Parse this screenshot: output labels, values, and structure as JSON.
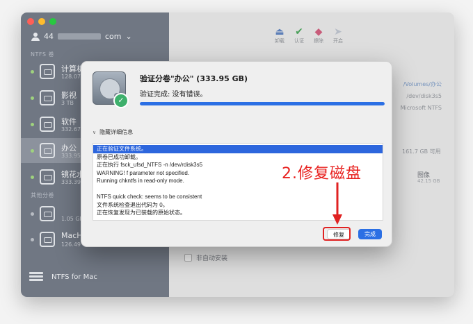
{
  "sidebar": {
    "account_prefix": "44",
    "account_suffix": "com",
    "section_ntfs": "NTFS 卷",
    "section_other": "其他分卷",
    "volumes": [
      {
        "name": "计算机",
        "size": "128.07"
      },
      {
        "name": "影视",
        "size": "3 TB"
      },
      {
        "name": "软件",
        "size": "332.67"
      },
      {
        "name": "办公",
        "size": "333.95"
      },
      {
        "name": "镜花水",
        "size": "333.39"
      }
    ],
    "other_volumes": [
      {
        "name": "",
        "size": "1.05 GB"
      },
      {
        "name": "MacHD",
        "size": "126.49"
      }
    ],
    "footer_label": "NTFS for Mac"
  },
  "toolbar": {
    "unmount_label": "卸载",
    "verify_label": "认证",
    "erase_label": "擦除",
    "open_label": "开启"
  },
  "info_panel": {
    "mount_path": "/Volumes/办公",
    "device": "/dev/disk3s5",
    "format": "Microsoft NTFS",
    "free_space": "161.7 GB 可用",
    "type_label": "图像",
    "type_size": "42.15 GB",
    "non_auto_mount_label": "非自动安装"
  },
  "dialog": {
    "title": "验证分卷\"办公\" (333.95 GB)",
    "status": "验证完成: 没有错误。",
    "progress_percent": 100,
    "details_toggle": "隐藏详细信息",
    "log_lines": [
      "正在验证文件系统。",
      "原卷已成功卸载。",
      "正在执行 fsck_ufsd_NTFS -n /dev/rdisk3s5",
      "WARNING! f parameter not specified.",
      "Running chkntfs in read-only mode.",
      "",
      "NTFS quick check: seems to be consistent",
      "文件系统检查退出代码为 0。",
      "正在恢复发现为已装载的原始状态。"
    ],
    "repair_button": "修复",
    "done_button": "完成"
  },
  "annotation": {
    "label": "2.修复磁盘",
    "color": "#e8201e"
  }
}
